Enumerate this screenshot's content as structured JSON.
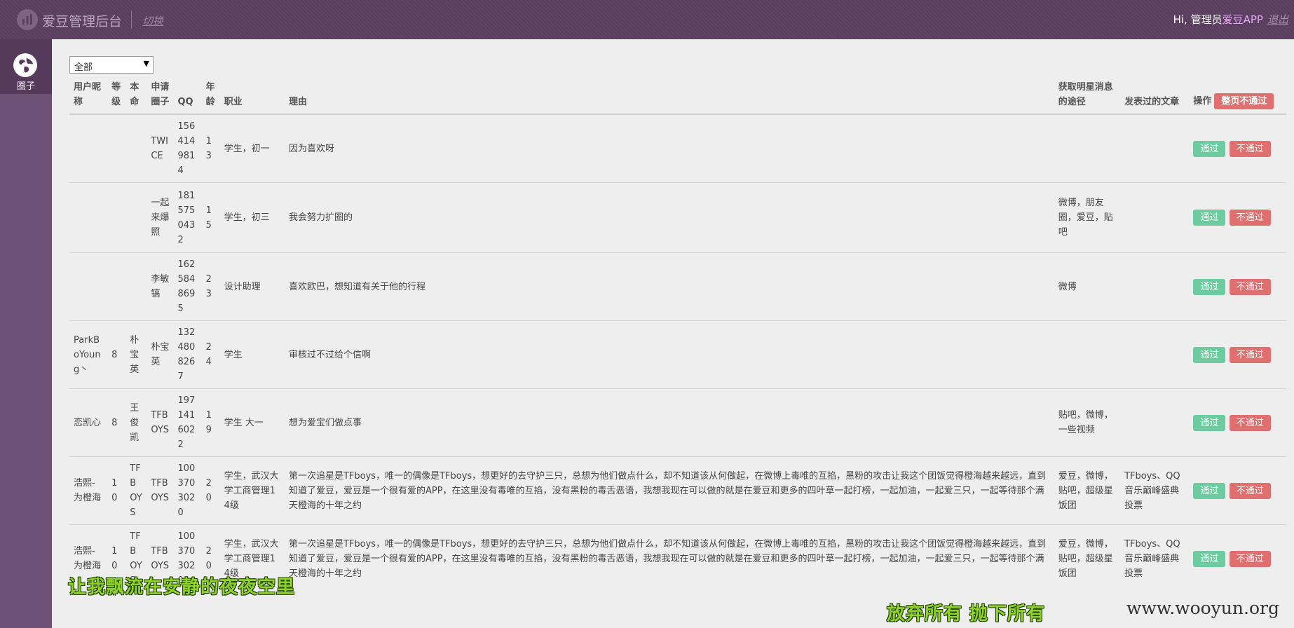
{
  "topbar": {
    "brand": "爱豆管理后台",
    "switch_label": "切换",
    "greeting": "Hi, 管理员",
    "user_name": "爱豆APP",
    "logout_label": "退出"
  },
  "sidebar": {
    "items": [
      {
        "label": "圈子",
        "icon": "globe-icon"
      }
    ]
  },
  "filter": {
    "selected": "全部"
  },
  "table": {
    "headers": {
      "nick": "用户昵称",
      "level": "等级",
      "name": "本命",
      "circle": "申请圈子",
      "qq": "QQ",
      "age": "年龄",
      "job": "职业",
      "reason": "理由",
      "source": "获取明星消息的途径",
      "articles": "发表过的文章",
      "op": "操作",
      "reject_page": "整页不通过"
    },
    "pass_label": "通过",
    "reject_label": "不通过",
    "rows": [
      {
        "nick": "",
        "level": "",
        "name": "",
        "circle": "TWICE",
        "qq": "1564149814",
        "age": "13",
        "job": "学生，初一",
        "reason": "因为喜欢呀",
        "source": "",
        "articles": ""
      },
      {
        "nick": "",
        "level": "",
        "name": "",
        "circle": "一起来爆照",
        "qq": "1815750432",
        "age": "15",
        "job": "学生，初三",
        "reason": "我会努力扩圈的",
        "source": "微博，朋友圈，爱豆，贴吧",
        "articles": ""
      },
      {
        "nick": "",
        "level": "",
        "name": "",
        "circle": "李敏镐",
        "qq": "1625848695",
        "age": "23",
        "job": "设计助理",
        "reason": "喜欢欧巴，想知道有关于他的行程",
        "source": "微博",
        "articles": ""
      },
      {
        "nick": "ParkBoYoung丶",
        "level": "8",
        "name": "朴宝英",
        "circle": "朴宝英",
        "qq": "1324808267",
        "age": "24",
        "job": "学生",
        "reason": "审核过不过给个信啊",
        "source": "",
        "articles": ""
      },
      {
        "nick": "恋凯心",
        "level": "8",
        "name": "王俊凯",
        "circle": "TFBOYS",
        "qq": "1971416022",
        "age": "19",
        "job": "学生 大一",
        "reason": "想为爱宝们做点事",
        "source": "贴吧，微博，一些视频",
        "articles": ""
      },
      {
        "nick": "浩熙-为橙海",
        "level": "10",
        "name": "TFBOYS",
        "circle": "TFBOYS",
        "qq": "1003703020",
        "age": "20",
        "job": "学生，武汉大学工商管理14级",
        "reason": "第一次追星是TFboys，唯一的偶像是TFboys，想更好的去守护三只，总想为他们做点什么，却不知道该从何做起，在微博上毒唯的互掐，黑粉的攻击让我这个团饭觉得橙海越来越远，直到知道了爱豆，爱豆是一个很有爱的APP，在这里没有毒唯的互掐，没有黑粉的毒舌恶语，我想我现在可以做的就是在爱豆和更多的四叶草一起打榜，一起加油，一起爱三只，一起等待那个满天橙海的十年之约",
        "source": "爱豆，微博，贴吧，超级星饭团",
        "articles": "TFboys、QQ音乐巅峰盛典投票"
      },
      {
        "nick": "浩熙-为橙海",
        "level": "10",
        "name": "TFBOYS",
        "circle": "TFBOYS",
        "qq": "1003703020",
        "age": "20",
        "job": "学生，武汉大学工商管理14级",
        "reason": "第一次追星是TFboys，唯一的偶像是TFboys，想更好的去守护三只，总想为他们做点什么，却不知道该从何做起，在微博上毒唯的互掐，黑粉的攻击让我这个团饭觉得橙海越来越远，直到知道了爱豆，爱豆是一个很有爱的APP，在这里没有毒唯的互掐，没有黑粉的毒舌恶语，我想我现在可以做的就是在爱豆和更多的四叶草一起打榜，一起加油，一起爱三只，一起等待那个满天橙海的十年之约",
        "source": "爱豆，微博，贴吧，超级星饭团",
        "articles": "TFboys、QQ音乐巅峰盛典投票"
      }
    ]
  },
  "overlay": {
    "caption_left": "让我飘流在安静的夜夜空里",
    "caption_right": "放弃所有 抛下所有",
    "watermark": "www.wooyun.org"
  },
  "colors": {
    "topbar": "#5b3f62",
    "sidebar": "#6e4f76",
    "pass": "#6ccca0",
    "reject": "#e06f6f",
    "caption": "#8fd22a"
  }
}
